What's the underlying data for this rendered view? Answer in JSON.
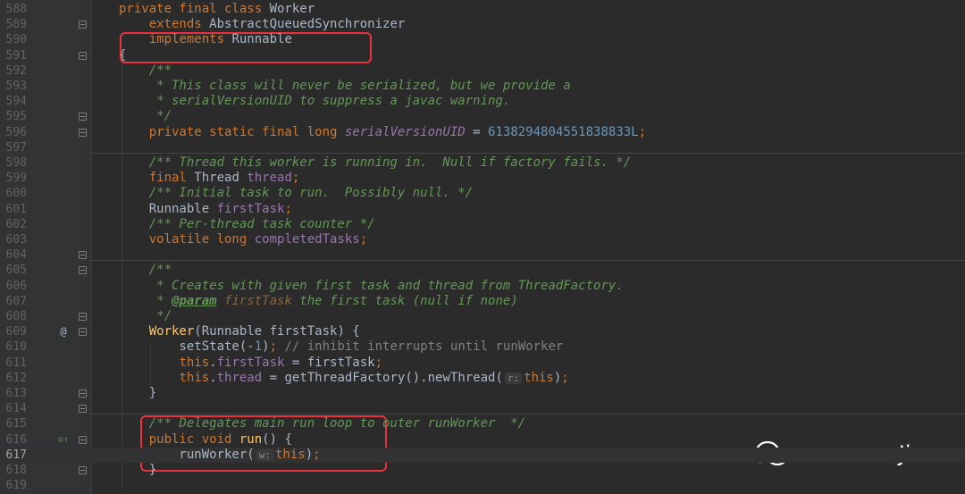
{
  "lines": [
    {
      "n": "588",
      "segs": [
        [
          "kw",
          "private final class "
        ],
        [
          "plain",
          "Worker"
        ]
      ]
    },
    {
      "n": "589",
      "segs": [
        [
          "plain",
          "    "
        ],
        [
          "kw",
          "extends "
        ],
        [
          "plain",
          "AbstractQueuedSynchronizer"
        ]
      ]
    },
    {
      "n": "590",
      "segs": [
        [
          "plain",
          "    "
        ],
        [
          "kw",
          "implements "
        ],
        [
          "plain",
          "Runnable"
        ]
      ]
    },
    {
      "n": "591",
      "segs": [
        [
          "plain",
          "{"
        ]
      ]
    },
    {
      "n": "592",
      "segs": [
        [
          "cm",
          "    /**"
        ]
      ]
    },
    {
      "n": "593",
      "segs": [
        [
          "cm",
          "     * This class will never be serialized, but we provide a"
        ]
      ]
    },
    {
      "n": "594",
      "segs": [
        [
          "cm",
          "     * serialVersionUID to suppress a javac warning."
        ]
      ]
    },
    {
      "n": "595",
      "segs": [
        [
          "cm",
          "     */"
        ]
      ]
    },
    {
      "n": "596",
      "segs": [
        [
          "plain",
          "    "
        ],
        [
          "kw",
          "private static final long "
        ],
        [
          "sfd",
          "serialVersionUID"
        ],
        [
          "plain",
          " = "
        ],
        [
          "num",
          "6138294804551838833L"
        ],
        [
          "kw",
          ";"
        ]
      ]
    },
    {
      "n": "597",
      "segs": []
    },
    {
      "n": "598",
      "segs": [
        [
          "cm",
          "    /** Thread this worker is running in.  Null if factory fails. */"
        ]
      ]
    },
    {
      "n": "599",
      "segs": [
        [
          "plain",
          "    "
        ],
        [
          "kw",
          "final "
        ],
        [
          "plain",
          "Thread "
        ],
        [
          "fd",
          "thread"
        ],
        [
          "kw",
          ";"
        ]
      ]
    },
    {
      "n": "600",
      "segs": [
        [
          "cm",
          "    /** Initial task to run.  Possibly null. */"
        ]
      ]
    },
    {
      "n": "601",
      "segs": [
        [
          "plain",
          "    Runnable "
        ],
        [
          "fd",
          "firstTask"
        ],
        [
          "kw",
          ";"
        ]
      ]
    },
    {
      "n": "602",
      "segs": [
        [
          "cm",
          "    /** Per-thread task counter */"
        ]
      ]
    },
    {
      "n": "603",
      "segs": [
        [
          "plain",
          "    "
        ],
        [
          "kw",
          "volatile long "
        ],
        [
          "fd",
          "completedTasks"
        ],
        [
          "kw",
          ";"
        ]
      ]
    },
    {
      "n": "604",
      "segs": []
    },
    {
      "n": "605",
      "segs": [
        [
          "cm",
          "    /**"
        ]
      ]
    },
    {
      "n": "606",
      "segs": [
        [
          "cm",
          "     * Creates with given first task and thread from ThreadFactory."
        ]
      ]
    },
    {
      "n": "607",
      "segs": [
        [
          "cm",
          "     * "
        ],
        [
          "cmtag",
          "@param"
        ],
        [
          "cm",
          " "
        ],
        [
          "cmref",
          "firstTask"
        ],
        [
          "cm",
          " the first task (null if none)"
        ]
      ]
    },
    {
      "n": "608",
      "segs": [
        [
          "cm",
          "     */"
        ]
      ]
    },
    {
      "n": "609",
      "segs": [
        [
          "plain",
          "    "
        ],
        [
          "mth",
          "Worker"
        ],
        [
          "plain",
          "(Runnable firstTask) {"
        ]
      ]
    },
    {
      "n": "610",
      "segs": [
        [
          "plain",
          "        setState(-"
        ],
        [
          "num",
          "1"
        ],
        [
          "plain",
          ")"
        ],
        [
          "kw",
          "; "
        ],
        [
          "cmplain",
          "// inhibit interrupts until runWorker"
        ]
      ]
    },
    {
      "n": "611",
      "segs": [
        [
          "plain",
          "        "
        ],
        [
          "kw",
          "this"
        ],
        [
          "plain",
          "."
        ],
        [
          "fd",
          "firstTask"
        ],
        [
          "plain",
          " = firstTask"
        ],
        [
          "kw",
          ";"
        ]
      ]
    },
    {
      "n": "612",
      "segs": [
        [
          "plain",
          "        "
        ],
        [
          "kw",
          "this"
        ],
        [
          "plain",
          "."
        ],
        [
          "fd",
          "thread"
        ],
        [
          "plain",
          " = getThreadFactory().newThread("
        ],
        [
          "hint",
          "r:"
        ],
        [
          "kw",
          "this"
        ],
        [
          "plain",
          ")"
        ],
        [
          "kw",
          ";"
        ]
      ]
    },
    {
      "n": "613",
      "segs": [
        [
          "plain",
          "    }"
        ]
      ]
    },
    {
      "n": "614",
      "segs": []
    },
    {
      "n": "615",
      "segs": [
        [
          "cm",
          "    /** Delegates main run loop to outer runWorker  */"
        ]
      ]
    },
    {
      "n": "616",
      "segs": [
        [
          "plain",
          "    "
        ],
        [
          "kw",
          "public void "
        ],
        [
          "mth",
          "run"
        ],
        [
          "plain",
          "() {"
        ]
      ]
    },
    {
      "n": "617",
      "segs": [
        [
          "plain",
          "        runWorker("
        ],
        [
          "hint",
          "w:"
        ],
        [
          "kw",
          "this"
        ],
        [
          "plain",
          ")"
        ],
        [
          "kw",
          ";"
        ]
      ]
    },
    {
      "n": "618",
      "segs": [
        [
          "plain",
          "    }"
        ]
      ]
    },
    {
      "n": "619",
      "segs": []
    }
  ],
  "gutter_marks": {
    "609": "@",
    "616": "o↑"
  },
  "fold_lines": [
    "589",
    "591",
    "595",
    "596",
    "604",
    "605",
    "608",
    "609",
    "613",
    "614",
    "616",
    "618"
  ],
  "current_line": "617",
  "watermark": {
    "text": "crossoverJie",
    "icon": "wechat-icon"
  },
  "colors": {
    "keyword": "#cc7832",
    "comment": "#629755",
    "field": "#9876aa",
    "number": "#6897bb",
    "method": "#ffc66d",
    "highlight_box": "#e8333f"
  }
}
